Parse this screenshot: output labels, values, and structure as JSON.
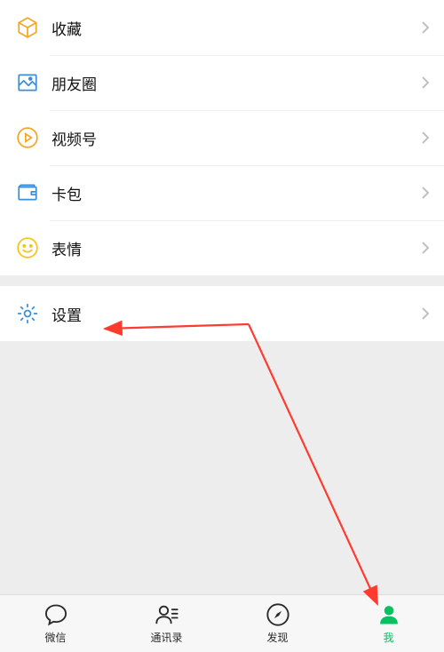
{
  "menu": {
    "favorites": "收藏",
    "moments": "朋友圈",
    "channels": "视频号",
    "cards": "卡包",
    "stickers": "表情",
    "settings": "设置"
  },
  "tabs": {
    "chats": "微信",
    "contacts": "通讯录",
    "discover": "发现",
    "me": "我"
  }
}
